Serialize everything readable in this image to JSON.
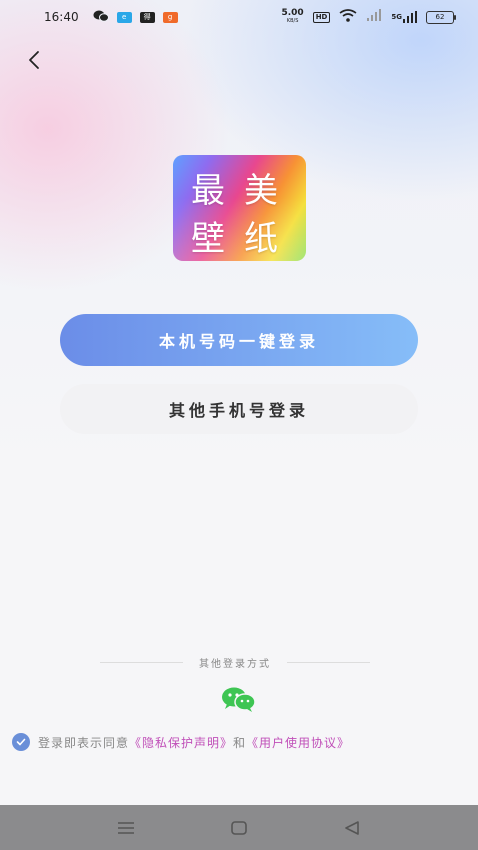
{
  "status_bar": {
    "time": "16:40",
    "app_icons": [
      "wechat-icon",
      "message-icon",
      "huya-icon",
      "taobao-icon"
    ],
    "net_speed_value": "5.00",
    "net_speed_unit": "KB/S",
    "hd_label": "HD",
    "signal_label": "5G",
    "battery": "62"
  },
  "logo": {
    "chars": [
      "最",
      "美",
      "壁",
      "纸"
    ],
    "gradient_colors": [
      "#5fa0ff",
      "#8e6cf0",
      "#e8478f",
      "#f79235",
      "#f5df3a",
      "#8fe05a"
    ]
  },
  "buttons": {
    "one_click_login": "本机号码一键登录",
    "other_phone_login": "其他手机号登录"
  },
  "other_login": {
    "label": "其他登录方式",
    "wechat_icon": "wechat-icon"
  },
  "agreement": {
    "checked": true,
    "prefix": "登录即表示同意",
    "privacy_link": "《隐私保护声明》",
    "connector": "和",
    "terms_link": "《用户使用协议》"
  },
  "nav_bar": {
    "items": [
      "menu-icon",
      "home-icon",
      "back-icon"
    ]
  },
  "colors": {
    "primary_start": "#6b8de8",
    "primary_end": "#86bdf8",
    "link": "#c04fb8",
    "check": "#6a8fd8"
  }
}
